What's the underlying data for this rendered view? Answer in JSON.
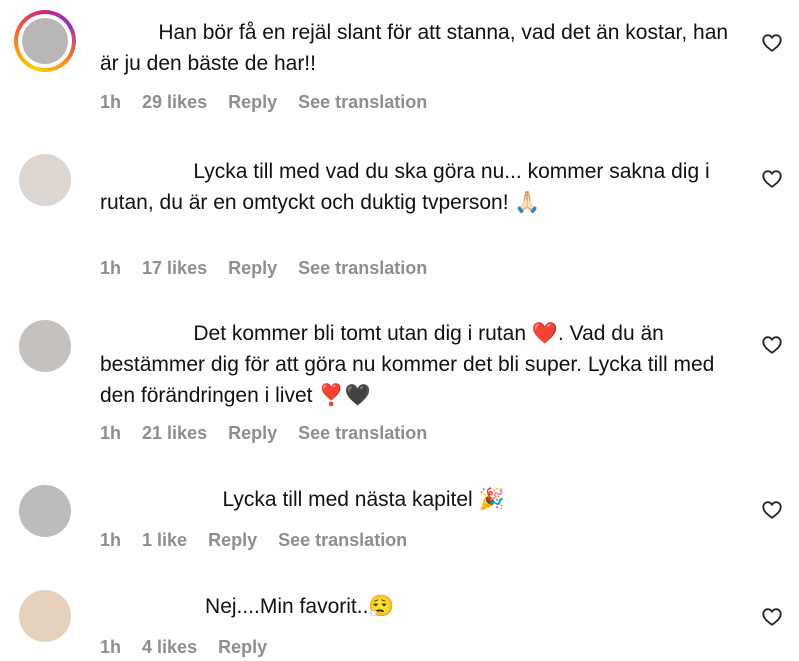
{
  "colors": {
    "text": "#111111",
    "meta": "#8e8e8e",
    "story_ring": [
      "#fdd100",
      "#fa7e1e",
      "#d62976",
      "#962fbf"
    ]
  },
  "comments": [
    {
      "avatar_color": "#b8b6b7",
      "has_story_ring": true,
      "text": "          Han bör få en rejäl slant för att stanna, vad det än kostar, han är ju den bäste de har!!",
      "time": "1h",
      "likes": "29 likes",
      "reply": "Reply",
      "translate": "See translation",
      "icon": "heart-outline-icon"
    },
    {
      "avatar_color": "#ddd5cf",
      "has_story_ring": false,
      "text": "                Lycka till med vad du ska göra nu... kommer sakna dig i rutan, du är en omtyckt och duktig tvperson! 🙏🏻",
      "time": "1h",
      "likes": "17 likes",
      "reply": "Reply",
      "translate": "See translation",
      "icon": "heart-outline-icon"
    },
    {
      "avatar_color": "#c5c1bf",
      "has_story_ring": false,
      "text": "                Det kommer bli tomt utan dig i rutan ❤️. Vad du än bestämmer dig för att göra nu kommer det bli super. Lycka till med den förändringen i livet ❣️🖤",
      "time": "1h",
      "likes": "21 likes",
      "reply": "Reply",
      "translate": "See translation",
      "icon": "heart-outline-icon"
    },
    {
      "avatar_color": "#bdbbbd",
      "has_story_ring": false,
      "text": "                     Lycka till med nästa kapitel 🎉",
      "time": "1h",
      "likes": "1 like",
      "reply": "Reply",
      "translate": "See translation",
      "icon": "heart-outline-icon"
    },
    {
      "avatar_color": "#e6d1bc",
      "has_story_ring": false,
      "text": "                  Nej....Min favorit..😮‍💨",
      "time": "1h",
      "likes": "4 likes",
      "reply": "Reply",
      "icon": "heart-outline-icon"
    }
  ]
}
